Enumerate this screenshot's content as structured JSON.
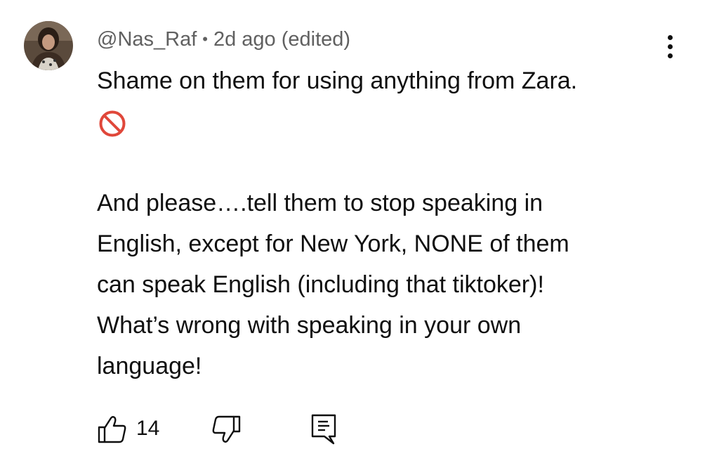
{
  "comment": {
    "author": "@Nas_Raf",
    "separator": "•",
    "timestamp": "2d ago (edited)",
    "lines_para1": [
      "Shame on them for using anything from Zara."
    ],
    "emoji": "prohibited",
    "lines_para2": [
      "And please….tell them to stop speaking in",
      "English, except for New York, NONE of them",
      "can speak English (including that tiktoker)!",
      "What’s wrong with speaking in your own",
      "language!"
    ],
    "like_count": "14"
  },
  "icons": {
    "menu": "more-vert-icon",
    "like": "thumbs-up-icon",
    "dislike": "thumbs-down-icon",
    "reply": "reply-comment-icon",
    "emoji": "prohibited-icon"
  },
  "colors": {
    "text": "#0f0f0f",
    "meta": "#606060",
    "prohibited": "#e0473a"
  }
}
